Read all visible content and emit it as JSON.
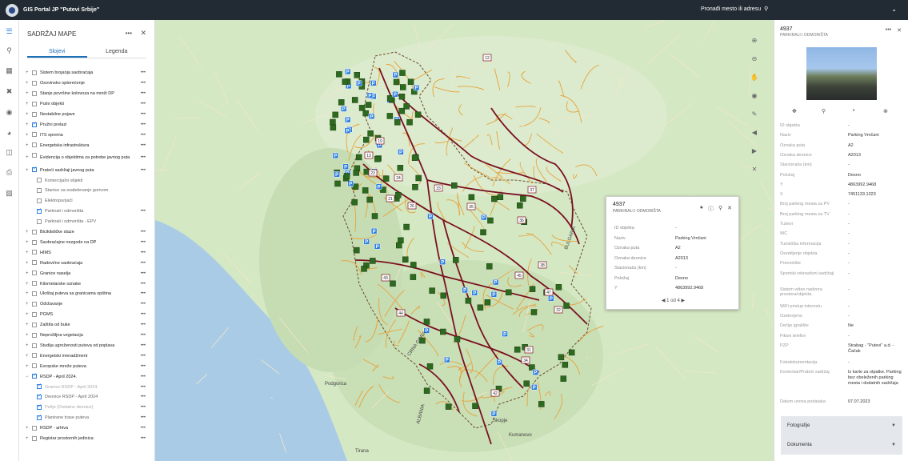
{
  "header": {
    "title": "GIS Portal JP \"Putevi Srbije\"",
    "search_placeholder": "Pronađi mesto ili adresu"
  },
  "toc": {
    "title": "SADRŽAJ MAPE",
    "tabs": [
      "Slojevi",
      "Legenda"
    ],
    "layers": [
      {
        "label": "Sistem brojanja saobraćaja",
        "checked": false,
        "sub": false
      },
      {
        "label": "Osovinsko opterećenje",
        "checked": false,
        "sub": false
      },
      {
        "label": "Stanje površine kolovoza na mreži DP",
        "checked": false,
        "sub": false
      },
      {
        "label": "Putni objekti",
        "checked": false,
        "sub": false
      },
      {
        "label": "Nestabilne pojave",
        "checked": false,
        "sub": false
      },
      {
        "label": "Pružni prelazi",
        "checked": true,
        "sub": false
      },
      {
        "label": "ITS oprema",
        "checked": false,
        "sub": false
      },
      {
        "label": "Energetska infrastruktura",
        "checked": false,
        "sub": false
      },
      {
        "label": "Evidencija o objektima za potrebe javnog puta",
        "checked": false,
        "sub": false
      },
      {
        "label": "Prateći sadržaji javnog puta",
        "checked": true,
        "sub": false
      },
      {
        "label": "Komercijalni objekti",
        "checked": false,
        "sub": true
      },
      {
        "label": "Stanice za snabdevanje gorivom",
        "checked": false,
        "sub": true
      },
      {
        "label": "Elektropunjači",
        "checked": false,
        "sub": true
      },
      {
        "label": "Parkirali i odmorišta",
        "checked": true,
        "sub": true
      },
      {
        "label": "Parkirali i odmorišta - EPV",
        "checked": false,
        "sub": true
      },
      {
        "label": "Biciklističke staze",
        "checked": false,
        "sub": false
      },
      {
        "label": "Saobraćajne nezgode na DP",
        "checked": false,
        "sub": false
      },
      {
        "label": "HIMS",
        "checked": false,
        "sub": false
      },
      {
        "label": "Radovi/ne saobraćaja",
        "checked": false,
        "sub": false
      },
      {
        "label": "Granice naselja",
        "checked": false,
        "sub": false
      },
      {
        "label": "Kilometarske oznake",
        "checked": false,
        "sub": false
      },
      {
        "label": "Ukrštaj puteva sa granicama opština",
        "checked": false,
        "sub": false
      },
      {
        "label": "Održavanje",
        "checked": false,
        "sub": false
      },
      {
        "label": "PGMS",
        "checked": false,
        "sub": false
      },
      {
        "label": "Zaštita od buke",
        "checked": false,
        "sub": false
      },
      {
        "label": "Neprožiljna vegetacija",
        "checked": false,
        "sub": false
      },
      {
        "label": "Studija ugroženosti puteva od poplava",
        "checked": false,
        "sub": false
      },
      {
        "label": "Energetski menadžment",
        "checked": false,
        "sub": false
      },
      {
        "label": "Evropske mreže puteva",
        "checked": false,
        "sub": false
      },
      {
        "label": "RSDP - April 2024.",
        "checked": true,
        "sub": false,
        "expanded": true
      },
      {
        "label": "Granice RSDP - April 2024.",
        "checked": true,
        "sub": true,
        "dim": true
      },
      {
        "label": "Deonice RSDP - April 2024",
        "checked": true,
        "sub": true
      },
      {
        "label": "Petlje (Dodatne deonice)",
        "checked": true,
        "sub": true,
        "dim": true
      },
      {
        "label": "Planirane trase puteva",
        "checked": true,
        "sub": true
      },
      {
        "label": "RSDP - arhiva",
        "checked": false,
        "sub": false
      },
      {
        "label": "Registar prostornih jedinica",
        "checked": false,
        "sub": false
      }
    ]
  },
  "map": {
    "place_labels": [
      "BULGARIA",
      "Podgorica",
      "Skopje",
      "Kumanovo",
      "Tirana",
      "ALBANIA",
      "CRNA GORA"
    ],
    "road_numbers": [
      "12",
      "19",
      "13",
      "23",
      "21",
      "24",
      "26",
      "33",
      "35",
      "36",
      "37",
      "38",
      "43",
      "44",
      "45",
      "47",
      "22",
      "31",
      "34",
      "42"
    ]
  },
  "popup": {
    "title": "4937",
    "subtitle": "PARKIRALI I ODMORIŠTA",
    "rows": [
      {
        "k": "ID objekta",
        "v": "-"
      },
      {
        "k": "Naziv",
        "v": "Parking Vrnčani"
      },
      {
        "k": "Oznaka puta",
        "v": "A2"
      },
      {
        "k": "Oznaka deonice",
        "v": "A2013"
      },
      {
        "k": "Stacionaža (km)",
        "v": "-"
      },
      {
        "k": "Položaj",
        "v": "Desno"
      },
      {
        "k": "Y",
        "v": "4863992.9468"
      }
    ],
    "pager": "1 od 4"
  },
  "rpanel": {
    "title": "4937",
    "subtitle": "PARKIRALI I ODMORIŠTA",
    "fields": [
      {
        "k": "ID objekta",
        "v": "-"
      },
      {
        "k": "Naziv",
        "v": "Parking Vrnčani"
      },
      {
        "k": "Oznaka puta",
        "v": "A2"
      },
      {
        "k": "Oznaka deonice",
        "v": "A2013"
      },
      {
        "k": "Stacionaža (km)",
        "v": "-"
      },
      {
        "k": "Položaj",
        "v": "Desno"
      },
      {
        "k": "Y",
        "v": "4863992.9468"
      },
      {
        "k": "X",
        "v": "7451133.1023"
      },
      {
        "k": "Broj parking mesta za PV",
        "v": "-"
      },
      {
        "k": "Broj parking mesta za TV",
        "v": "-"
      },
      {
        "k": "Tuševi",
        "v": "-"
      },
      {
        "k": "WC",
        "v": "-"
      },
      {
        "k": "Turistička informacija",
        "v": "-"
      },
      {
        "k": "Osvetljenje objekta",
        "v": "-"
      },
      {
        "k": "Prenoćište",
        "v": "-"
      },
      {
        "k": "Sportski rekreativni sadržaji",
        "v": "-"
      },
      {
        "k": "Sistem video nadzora prostora/objekta",
        "v": "-"
      },
      {
        "k": "WiFi pristup internetu",
        "v": "-"
      },
      {
        "k": "Ozelenjeno",
        "v": "-"
      },
      {
        "k": "Dečije igralište",
        "v": "Ne"
      },
      {
        "k": "Fiksni telefon",
        "v": "-"
      },
      {
        "k": "PZP",
        "v": "Strabag - \"Putevi\" a.d. - Čačak"
      },
      {
        "k": "Fotodokumentacija",
        "v": "-"
      },
      {
        "k": "Komentar/Prateći sadržaj",
        "v": "Iz karte za otpatke. Parking bez obeleženih parking mesta i dodatnih sadržaja"
      },
      {
        "k": "Datum unosa podataka",
        "v": "07.07.2023"
      }
    ],
    "accordions": [
      "Fotografije",
      "Dokumenta"
    ]
  },
  "colors": {
    "header_bg": "#222b33",
    "accent": "#2a7de1",
    "state_road": "#7a1020",
    "regional_road": "#e8a23a",
    "marker_green": "#2d6a1f",
    "marker_blue": "#2a7de1"
  }
}
